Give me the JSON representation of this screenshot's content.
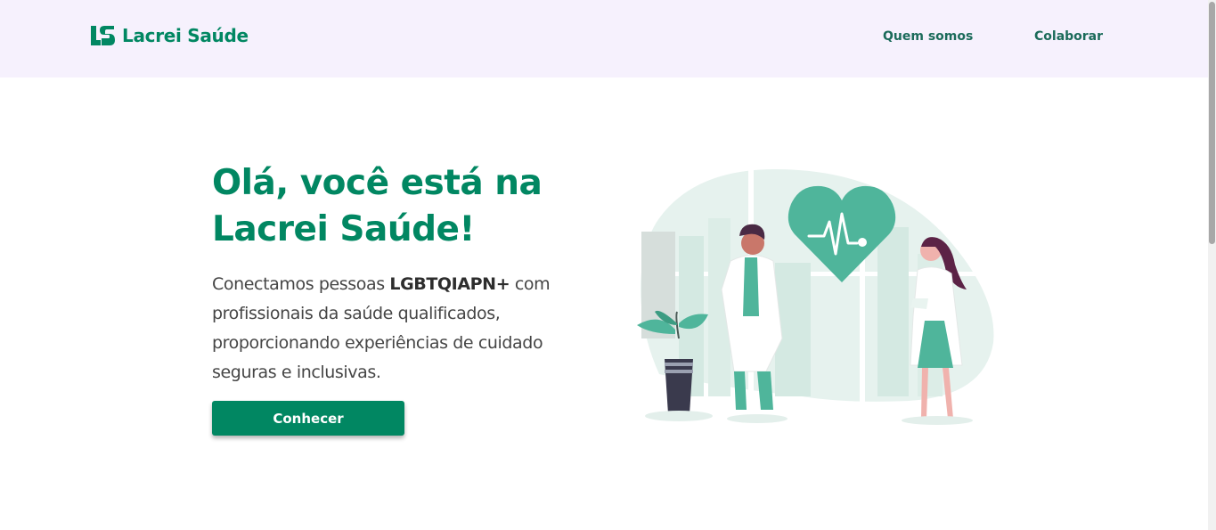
{
  "header": {
    "logo_text": "Lacrei Saúde",
    "nav": [
      {
        "label": "Quem somos"
      },
      {
        "label": "Colaborar"
      }
    ]
  },
  "hero": {
    "title": "Olá, você está na Lacrei Saúde!",
    "text_before": "Conectamos pessoas ",
    "text_bold": "LGBTQIAPN+",
    "text_after": " com profissionais da saúde qualificados, proporcionando experiências de cuidado seguras e inclusivas.",
    "button_label": "Conhecer"
  },
  "colors": {
    "brand": "#018762",
    "header_bg": "#f6f1fd",
    "illustration_bg": "#e6f2ee",
    "heart": "#4fb59b"
  }
}
